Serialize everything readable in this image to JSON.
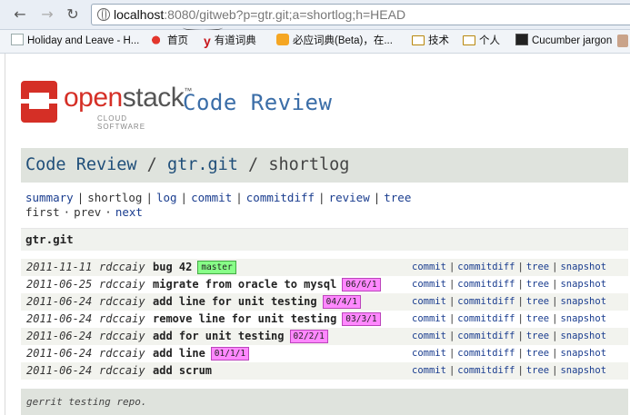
{
  "browser": {
    "url_host": "localhost",
    "url_rest": ":8080/gitweb?p=gtr.git;a=shortlog;h=HEAD",
    "bookmarks": [
      {
        "label": "Holiday and Leave - H...",
        "icon": "page-icon"
      },
      {
        "label": "首页",
        "icon": "weibo-icon"
      },
      {
        "label": "有道词典",
        "icon": "youdao-icon"
      },
      {
        "label": "必应词典(Beta)，在...",
        "icon": "bing-icon"
      },
      {
        "label": "技术",
        "icon": "folder-icon"
      },
      {
        "label": "个人",
        "icon": "folder-icon"
      },
      {
        "label": "Cucumber jargon",
        "icon": "page-icon"
      }
    ]
  },
  "header": {
    "logo_word_a": "open",
    "logo_word_b": "stack",
    "logo_sub": "CLOUD SOFTWARE",
    "logo_tm": "™",
    "site_title": "Code Review"
  },
  "breadcrumb": {
    "part1": "Code Review",
    "sep": " / ",
    "part2": "gtr.git",
    "part3": "shortlog"
  },
  "nav": {
    "links": [
      "summary",
      "shortlog",
      "log",
      "commit",
      "commitdiff",
      "review",
      "tree"
    ],
    "paging": [
      "first",
      "prev",
      "next"
    ],
    "paging_sep": "·",
    "link_sep": "|"
  },
  "project": "gtr.git",
  "commits": [
    {
      "age": "2011-11-11",
      "author": "rdccaiy",
      "subject": "bug 42",
      "tag": "master",
      "tag_type": "head"
    },
    {
      "age": "2011-06-25",
      "author": "rdccaiy",
      "subject": "migrate from oracle to mysql",
      "tag": "06/6/1",
      "tag_type": "refs"
    },
    {
      "age": "2011-06-24",
      "author": "rdccaiy",
      "subject": "add line for unit testing",
      "tag": "04/4/1",
      "tag_type": "refs"
    },
    {
      "age": "2011-06-24",
      "author": "rdccaiy",
      "subject": "remove line for unit testing",
      "tag": "03/3/1",
      "tag_type": "refs"
    },
    {
      "age": "2011-06-24",
      "author": "rdccaiy",
      "subject": "add for unit testing",
      "tag": "02/2/1",
      "tag_type": "refs"
    },
    {
      "age": "2011-06-24",
      "author": "rdccaiy",
      "subject": "add line",
      "tag": "01/1/1",
      "tag_type": "refs"
    },
    {
      "age": "2011-06-24",
      "author": "rdccaiy",
      "subject": "add scrum",
      "tag": "",
      "tag_type": ""
    }
  ],
  "row_links": [
    "commit",
    "commitdiff",
    "tree",
    "snapshot"
  ],
  "footer": {
    "description": "gerrit testing repo."
  }
}
